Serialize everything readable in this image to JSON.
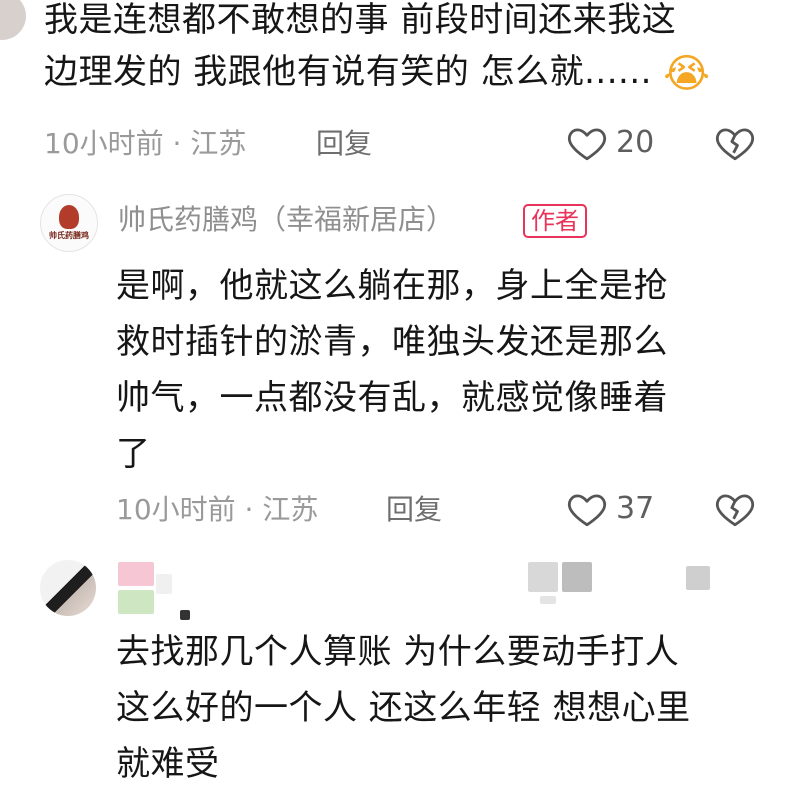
{
  "comment1": {
    "text_line1": "我是连想都不敢想的事 前段时间还来我这",
    "text_line2": "边理发的 我跟他有说有笑的 怎么就......",
    "emoji": "😭",
    "meta": "10小时前 · 江苏",
    "reply_label": "回复",
    "like_count": "20"
  },
  "comment2": {
    "username": "帅氏药膳鸡（幸福新居店）",
    "author_badge": "作者",
    "avatar_text": "帅氏药膳鸡",
    "text_line1": "是啊，他就这么躺在那，身上全是抢",
    "text_line2": "救时插针的淤青，唯独头发还是那么",
    "text_line3": "帅气，一点都没有乱，就感觉像睡着",
    "text_line4": "了",
    "meta": "10小时前 · 江苏",
    "reply_label": "回复",
    "like_count": "37"
  },
  "comment3": {
    "text_line1": "去找那几个人算账 为什么要动手打人",
    "text_line2": "这么好的一个人 还这么年轻 想想心里",
    "text_line3": "就难受"
  },
  "colors": {
    "accent": "#e8335a",
    "meta_gray": "#9a9a9a"
  }
}
